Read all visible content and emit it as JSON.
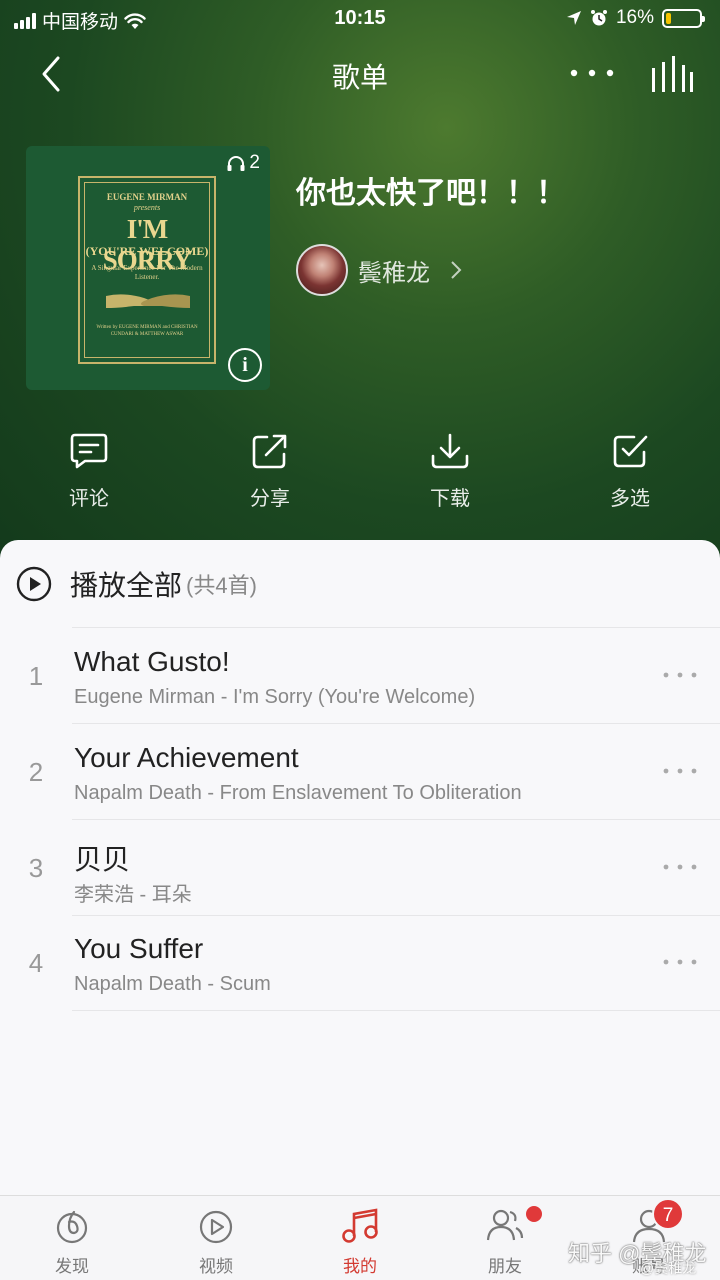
{
  "status_bar": {
    "carrier": "中国移动",
    "time": "10:15",
    "battery": "16%",
    "battery_level": 0.16
  },
  "nav": {
    "title": "歌单"
  },
  "playlist": {
    "title": "你也太快了吧！！！",
    "play_count": "2",
    "creator": "鬓稚龙"
  },
  "cover": {
    "line1": "EUGENE MIRMAN",
    "line2": "presents",
    "line3": "I'M SORRY",
    "line4": "(YOU'RE WELCOME)",
    "line5": "A Singular Experience For The Modern Listener.",
    "line6": "Written by EUGENE MIRMAN and CHRISTIAN CUNDARI & MATTHEW ASWAR",
    "info": "i"
  },
  "actions": [
    {
      "label": "评论",
      "icon": "comment-icon"
    },
    {
      "label": "分享",
      "icon": "share-icon"
    },
    {
      "label": "下载",
      "icon": "download-icon"
    },
    {
      "label": "多选",
      "icon": "multiselect-icon"
    }
  ],
  "play_all": {
    "label": "播放全部",
    "count": "(共4首)"
  },
  "songs": [
    {
      "num": "1",
      "title": "What Gusto!",
      "subtitle": "Eugene Mirman - I'm Sorry (You're Welcome)"
    },
    {
      "num": "2",
      "title": "Your Achievement",
      "subtitle": "Napalm Death - From Enslavement To Obliteration"
    },
    {
      "num": "3",
      "title": "贝贝",
      "subtitle": "李荣浩 - 耳朵"
    },
    {
      "num": "4",
      "title": "You Suffer",
      "subtitle": "Napalm Death - Scum"
    }
  ],
  "tabs": [
    {
      "label": "发现",
      "icon": "discover-icon"
    },
    {
      "label": "视频",
      "icon": "video-icon"
    },
    {
      "label": "我的",
      "icon": "music-note-icon",
      "active": true
    },
    {
      "label": "朋友",
      "icon": "friends-icon"
    },
    {
      "label": "账号",
      "icon": "account-icon",
      "badge": "7"
    }
  ],
  "watermark": {
    "text": "知乎 @鬓稚龙",
    "sub": "@鬓稚龙"
  },
  "colors": {
    "accent": "#d33a31",
    "hero": "#1c4821",
    "badge": "#e0393a",
    "battery": "#f5c400"
  }
}
